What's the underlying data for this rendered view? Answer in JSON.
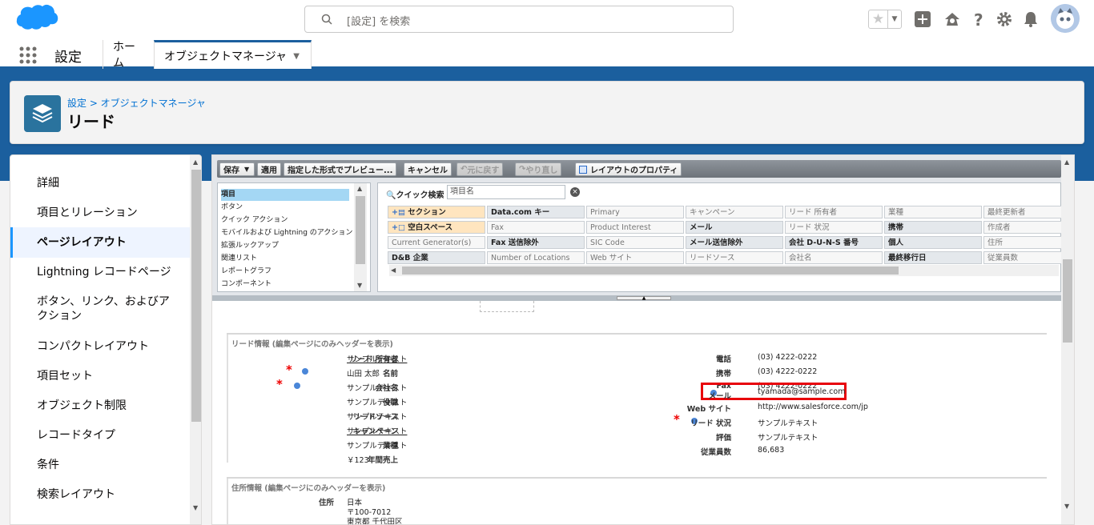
{
  "header": {
    "search_placeholder": "[設定] を検索"
  },
  "context_bar": {
    "app_name": "設定",
    "tabs": [
      {
        "label": "ホーム"
      },
      {
        "label": "オブジェクトマネージャ"
      }
    ]
  },
  "page_header": {
    "breadcrumb": "設定 > オブジェクトマネージャ",
    "title": "リード"
  },
  "left_nav": {
    "items": [
      {
        "label": "詳細"
      },
      {
        "label": "項目とリレーション"
      },
      {
        "label": "ページレイアウト"
      },
      {
        "label": "Lightning レコードページ"
      },
      {
        "label": "ボタン、リンク、およびア"
      },
      {
        "label": "クション"
      },
      {
        "label": "コンパクトレイアウト"
      },
      {
        "label": "項目セット"
      },
      {
        "label": "オブジェクト制限"
      },
      {
        "label": "レコードタイプ"
      },
      {
        "label": "条件"
      },
      {
        "label": "検索レイアウト"
      }
    ]
  },
  "toolbar": {
    "save": "保存",
    "apply": "適用",
    "preview": "指定した形式でプレビュー...",
    "cancel": "キャンセル",
    "undo": "元に戻す",
    "redo": "やり直し",
    "layout_props": "レイアウトのプロパティ"
  },
  "palette": {
    "categories": [
      "項目",
      "ボタン",
      "クイック アクション",
      "モバイルおよび Lightning のアクション",
      "拡張ルックアップ",
      "関連リスト",
      "レポートグラフ",
      "コンポーネント"
    ],
    "quick_find_label": "クイック検索",
    "quick_find_placeholder": "項目名",
    "fields": [
      [
        "セクション",
        "Data.com キー",
        "Primary",
        "キャンペーン",
        "リード 所有者",
        "業種",
        "最終更新者"
      ],
      [
        "空白スペース",
        "Fax",
        "Product Interest",
        "メール",
        "リード 状況",
        "携帯",
        "作成者"
      ],
      [
        "Current Generator(s)",
        "Fax 送信除外",
        "SIC Code",
        "メール送信除外",
        "会社 D-U-N-S 番号",
        "個人",
        "住所"
      ],
      [
        "D&B 企業",
        "Number of Locations",
        "Web サイト",
        "リードソース",
        "会社名",
        "最終移行日",
        "従業員数"
      ]
    ]
  },
  "layout": {
    "section1_title": "リード情報 (編集ページにのみヘッダーを表示)",
    "left_fields": [
      {
        "label": "リード 所有者",
        "value": "サンプルテキスト"
      },
      {
        "label": "名前",
        "value": "山田 太郎"
      },
      {
        "label": "会社名",
        "value": "サンプルテキスト"
      },
      {
        "label": "役職",
        "value": "サンプルテキスト"
      },
      {
        "label": "リードソース",
        "value": "サンプルテキスト"
      },
      {
        "label": "キャンペーン",
        "value": "サンプルテキスト"
      },
      {
        "label": "業種",
        "value": "サンプルテキスト"
      },
      {
        "label": "年間売上",
        "value": "￥123"
      }
    ],
    "right_fields": [
      {
        "label": "電話",
        "value": "(03) 4222-0222"
      },
      {
        "label": "携帯",
        "value": "(03) 4222-0222"
      },
      {
        "label": "Fax",
        "value": "(03) 4222-0222"
      },
      {
        "label": "メール",
        "value": "tyamada@sample.com"
      },
      {
        "label": "Web サイト",
        "value": "http://www.salesforce.com/jp"
      },
      {
        "label": "リード 状況",
        "value": "サンプルテキスト"
      },
      {
        "label": "評価",
        "value": "サンプルテキスト"
      },
      {
        "label": "従業員数",
        "value": "86,683"
      }
    ],
    "section2_title": "住所情報 (編集ページにのみヘッダーを表示)",
    "address_label": "住所",
    "address_lines": [
      "日本",
      "〒100-7012",
      "東京都 千代田区"
    ]
  },
  "colors": {
    "brand_blue": "#1b5f9e",
    "link": "#0070d2",
    "highlight": "#e8000b"
  }
}
